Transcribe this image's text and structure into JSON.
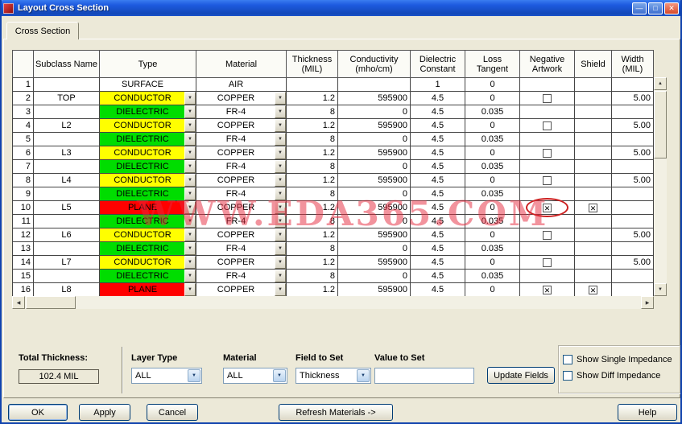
{
  "window": {
    "title": "Layout Cross Section"
  },
  "tabs": {
    "cross_section": "Cross Section"
  },
  "watermark": "WWW.EDA365.COM",
  "colors": {
    "type": {
      "SURFACE": "#ffffff",
      "CONDUCTOR": "#ffff00",
      "DIELECTRIC": "#00dd00",
      "PLANE": "#ff0000"
    },
    "watermark": "#e6283c"
  },
  "table": {
    "headers": [
      "",
      "Subclass Name",
      "Type",
      "Material",
      "Thickness\n(MIL)",
      "Conductivity\n(mho/cm)",
      "Dielectric\nConstant",
      "Loss\nTangent",
      "Negative\nArtwork",
      "Shield",
      "Width\n(MIL)"
    ],
    "rows": [
      {
        "num": "1",
        "subclass": "",
        "type": "SURFACE",
        "material": "AIR",
        "thickness": "",
        "conductivity": "",
        "dielectric": "1",
        "loss": "0",
        "negative": "none",
        "shield": "none",
        "width": "",
        "dropdown": false,
        "circled": false
      },
      {
        "num": "2",
        "subclass": "TOP",
        "type": "CONDUCTOR",
        "material": "COPPER",
        "thickness": "1.2",
        "conductivity": "595900",
        "dielectric": "4.5",
        "loss": "0",
        "negative": "unchecked",
        "shield": "none",
        "width": "5.00",
        "dropdown": true,
        "circled": false
      },
      {
        "num": "3",
        "subclass": "",
        "type": "DIELECTRIC",
        "material": "FR-4",
        "thickness": "8",
        "conductivity": "0",
        "dielectric": "4.5",
        "loss": "0.035",
        "negative": "none",
        "shield": "none",
        "width": "",
        "dropdown": true,
        "circled": false
      },
      {
        "num": "4",
        "subclass": "L2",
        "type": "CONDUCTOR",
        "material": "COPPER",
        "thickness": "1.2",
        "conductivity": "595900",
        "dielectric": "4.5",
        "loss": "0",
        "negative": "unchecked",
        "shield": "none",
        "width": "5.00",
        "dropdown": true,
        "circled": false
      },
      {
        "num": "5",
        "subclass": "",
        "type": "DIELECTRIC",
        "material": "FR-4",
        "thickness": "8",
        "conductivity": "0",
        "dielectric": "4.5",
        "loss": "0.035",
        "negative": "none",
        "shield": "none",
        "width": "",
        "dropdown": true,
        "circled": false
      },
      {
        "num": "6",
        "subclass": "L3",
        "type": "CONDUCTOR",
        "material": "COPPER",
        "thickness": "1.2",
        "conductivity": "595900",
        "dielectric": "4.5",
        "loss": "0",
        "negative": "unchecked",
        "shield": "none",
        "width": "5.00",
        "dropdown": true,
        "circled": false
      },
      {
        "num": "7",
        "subclass": "",
        "type": "DIELECTRIC",
        "material": "FR-4",
        "thickness": "8",
        "conductivity": "0",
        "dielectric": "4.5",
        "loss": "0.035",
        "negative": "none",
        "shield": "none",
        "width": "",
        "dropdown": true,
        "circled": false
      },
      {
        "num": "8",
        "subclass": "L4",
        "type": "CONDUCTOR",
        "material": "COPPER",
        "thickness": "1.2",
        "conductivity": "595900",
        "dielectric": "4.5",
        "loss": "0",
        "negative": "unchecked",
        "shield": "none",
        "width": "5.00",
        "dropdown": true,
        "circled": false
      },
      {
        "num": "9",
        "subclass": "",
        "type": "DIELECTRIC",
        "material": "FR-4",
        "thickness": "8",
        "conductivity": "0",
        "dielectric": "4.5",
        "loss": "0.035",
        "negative": "none",
        "shield": "none",
        "width": "",
        "dropdown": true,
        "circled": false
      },
      {
        "num": "10",
        "subclass": "L5",
        "type": "PLANE",
        "material": "COPPER",
        "thickness": "1.2",
        "conductivity": "595900",
        "dielectric": "4.5",
        "loss": "0",
        "negative": "checked",
        "shield": "checked",
        "width": "",
        "dropdown": true,
        "circled": true
      },
      {
        "num": "11",
        "subclass": "",
        "type": "DIELECTRIC",
        "material": "FR-4",
        "thickness": "8",
        "conductivity": "0",
        "dielectric": "4.5",
        "loss": "0.035",
        "negative": "none",
        "shield": "none",
        "width": "",
        "dropdown": true,
        "circled": false
      },
      {
        "num": "12",
        "subclass": "L6",
        "type": "CONDUCTOR",
        "material": "COPPER",
        "thickness": "1.2",
        "conductivity": "595900",
        "dielectric": "4.5",
        "loss": "0",
        "negative": "unchecked",
        "shield": "none",
        "width": "5.00",
        "dropdown": true,
        "circled": false
      },
      {
        "num": "13",
        "subclass": "",
        "type": "DIELECTRIC",
        "material": "FR-4",
        "thickness": "8",
        "conductivity": "0",
        "dielectric": "4.5",
        "loss": "0.035",
        "negative": "none",
        "shield": "none",
        "width": "",
        "dropdown": true,
        "circled": false
      },
      {
        "num": "14",
        "subclass": "L7",
        "type": "CONDUCTOR",
        "material": "COPPER",
        "thickness": "1.2",
        "conductivity": "595900",
        "dielectric": "4.5",
        "loss": "0",
        "negative": "unchecked",
        "shield": "none",
        "width": "5.00",
        "dropdown": true,
        "circled": false
      },
      {
        "num": "15",
        "subclass": "",
        "type": "DIELECTRIC",
        "material": "FR-4",
        "thickness": "8",
        "conductivity": "0",
        "dielectric": "4.5",
        "loss": "0.035",
        "negative": "none",
        "shield": "none",
        "width": "",
        "dropdown": true,
        "circled": false
      },
      {
        "num": "16",
        "subclass": "L8",
        "type": "PLANE",
        "material": "COPPER",
        "thickness": "1.2",
        "conductivity": "595900",
        "dielectric": "4.5",
        "loss": "0",
        "negative": "checked",
        "shield": "checked",
        "width": "",
        "dropdown": true,
        "circled": false
      }
    ]
  },
  "controls": {
    "total_thickness_label": "Total Thickness:",
    "total_thickness_value": "102.4 MIL",
    "layer_type_label": "Layer Type",
    "layer_type_value": "ALL",
    "material_label": "Material",
    "material_value": "ALL",
    "field_to_set_label": "Field to Set",
    "field_to_set_value": "Thickness",
    "value_to_set_label": "Value to Set",
    "value_to_set_value": "",
    "update_fields_button": "Update Fields",
    "show_single_impedance_label": "Show Single Impedance",
    "show_diff_impedance_label": "Show Diff Impedance"
  },
  "buttons": {
    "ok": "OK",
    "apply": "Apply",
    "cancel": "Cancel",
    "refresh_materials": "Refresh Materials ->",
    "help": "Help"
  }
}
